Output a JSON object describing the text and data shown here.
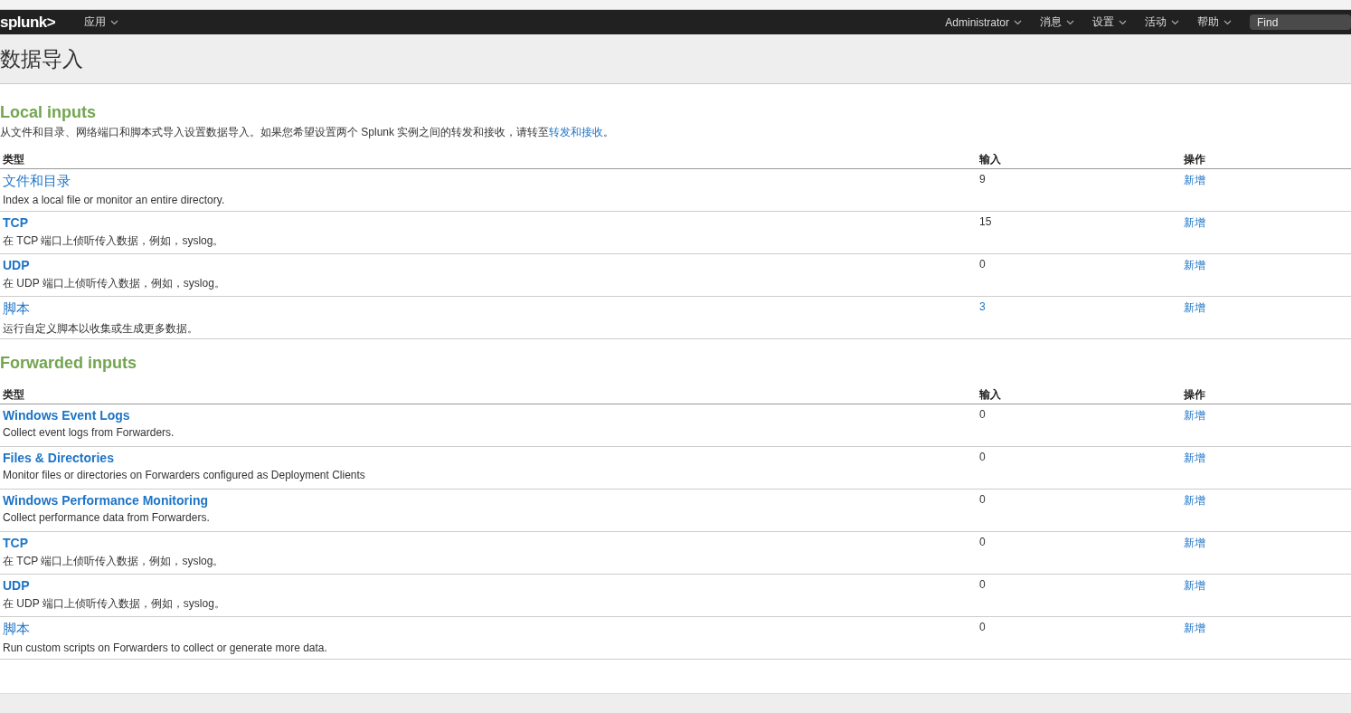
{
  "nav": {
    "logo": "splunk>",
    "apps_menu": "应用",
    "menus": [
      "Administrator",
      "消息",
      "设置",
      "活动",
      "帮助"
    ],
    "search": {
      "placeholder": "Find"
    }
  },
  "page_title": "数据导入",
  "sections": [
    {
      "title": "Local inputs",
      "description": "从文件和目录、网络端口和脚本式导入设置数据导入。如果您希望设置两个 Splunk 实例之间的转发和接收，请转至",
      "description_link": "转发和接收",
      "description_end": "。",
      "columns": [
        "类型",
        "输入",
        "操作"
      ],
      "rows": [
        {
          "name": "文件和目录",
          "description": "Index a local file or monitor an entire directory.",
          "count": "9",
          "count_link": false,
          "action": "新增"
        },
        {
          "name": "TCP",
          "description": "在 TCP 端口上侦听传入数据，例如，syslog。",
          "count": "15",
          "count_link": false,
          "action": "新增"
        },
        {
          "name": "UDP",
          "description": "在 UDP 端口上侦听传入数据，例如，syslog。",
          "count": "0",
          "count_link": false,
          "action": "新增"
        },
        {
          "name": "脚本",
          "description": "运行自定义脚本以收集或生成更多数据。",
          "count": "3",
          "count_link": true,
          "action": "新增"
        }
      ]
    },
    {
      "title": "Forwarded inputs",
      "columns": [
        "类型",
        "输入",
        "操作"
      ],
      "rows": [
        {
          "name": "Windows Event Logs",
          "description": "Collect event logs from Forwarders.",
          "count": "0",
          "count_link": false,
          "action": "新增"
        },
        {
          "name": "Files & Directories",
          "description": "Monitor files or directories on Forwarders configured as Deployment Clients",
          "count": "0",
          "count_link": false,
          "action": "新增"
        },
        {
          "name": "Windows Performance Monitoring",
          "description": "Collect performance data from Forwarders.",
          "count": "0",
          "count_link": false,
          "action": "新增"
        },
        {
          "name": "TCP",
          "description": "在 TCP 端口上侦听传入数据，例如，syslog。",
          "count": "0",
          "count_link": false,
          "action": "新增"
        },
        {
          "name": "UDP",
          "description": "在 UDP 端口上侦听传入数据，例如，syslog。",
          "count": "0",
          "count_link": false,
          "action": "新增"
        },
        {
          "name": "脚本",
          "description": "Run custom scripts on Forwarders to collect or generate more data.",
          "count": "0",
          "count_link": false,
          "action": "新增"
        }
      ]
    }
  ]
}
